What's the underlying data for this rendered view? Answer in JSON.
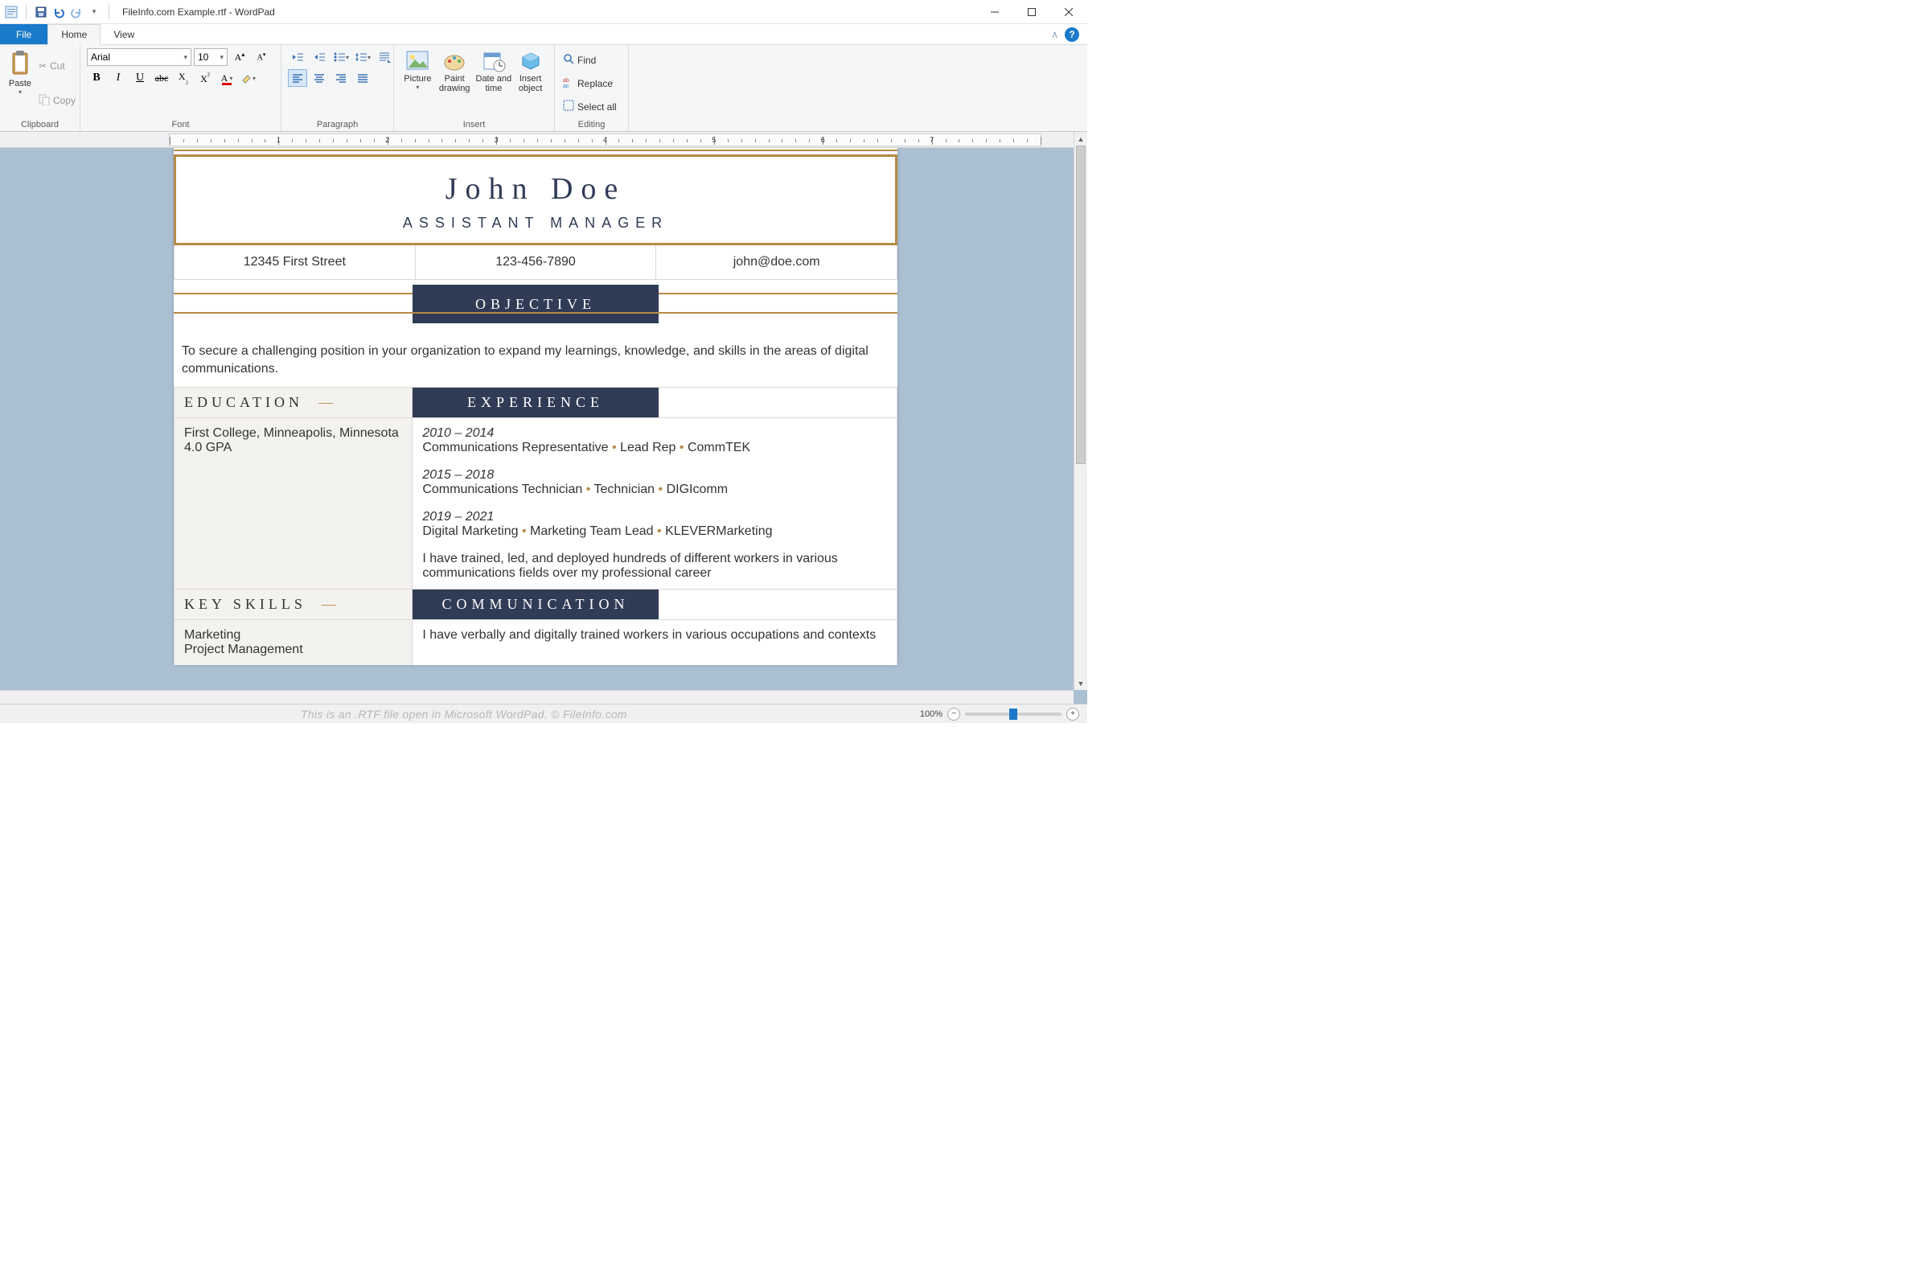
{
  "window": {
    "title": "FileInfo.com Example.rtf - WordPad"
  },
  "tabs": {
    "file": "File",
    "home": "Home",
    "view": "View"
  },
  "ribbon": {
    "clipboard": {
      "label": "Clipboard",
      "paste": "Paste",
      "cut": "Cut",
      "copy": "Copy"
    },
    "font": {
      "label": "Font",
      "name": "Arial",
      "size": "10"
    },
    "paragraph": {
      "label": "Paragraph"
    },
    "insert": {
      "label": "Insert",
      "picture": "Picture",
      "paint": "Paint drawing",
      "datetime": "Date and time",
      "object": "Insert object"
    },
    "editing": {
      "label": "Editing",
      "find": "Find",
      "replace": "Replace",
      "selectall": "Select all"
    }
  },
  "ruler": {
    "marks": [
      "1",
      "2",
      "3",
      "4",
      "5",
      "6",
      "7"
    ]
  },
  "document": {
    "name": "John Doe",
    "role": "ASSISTANT MANAGER",
    "contact": {
      "address": "12345 First Street",
      "phone": "123-456-7890",
      "email": "john@doe.com"
    },
    "objective_label": "OBJECTIVE",
    "objective_text": "To secure a challenging position in your organization to expand my learnings, knowledge, and skills in the areas of digital communications.",
    "education_label": "EDUCATION",
    "experience_label": "EXPERIENCE",
    "education": {
      "line1": "First College, Minneapolis, Minnesota",
      "line2": "4.0 GPA"
    },
    "experience": [
      {
        "dates": "2010 – 2014",
        "role": "Communications Representative",
        "title": "Lead Rep",
        "company": "CommTEK"
      },
      {
        "dates": "2015 – 2018",
        "role": "Communications Technician",
        "title": "Technician",
        "company": "DIGIcomm"
      },
      {
        "dates": "2019 – 2021",
        "role": "Digital Marketing",
        "title": "Marketing Team Lead",
        "company": "KLEVERMarketing"
      }
    ],
    "experience_summary": "I have trained, led, and deployed hundreds of different workers in various communications fields over my professional career",
    "keyskills_label": "KEY SKILLS",
    "communication_label": "COMMUNICATION",
    "skills": [
      "Marketing",
      "Project Management"
    ],
    "communication_text": "I have verbally and digitally trained workers in various occupations and contexts"
  },
  "status": {
    "watermark": "This is an .RTF file open in Microsoft WordPad. © FileInfo.com",
    "zoom": "100%"
  }
}
